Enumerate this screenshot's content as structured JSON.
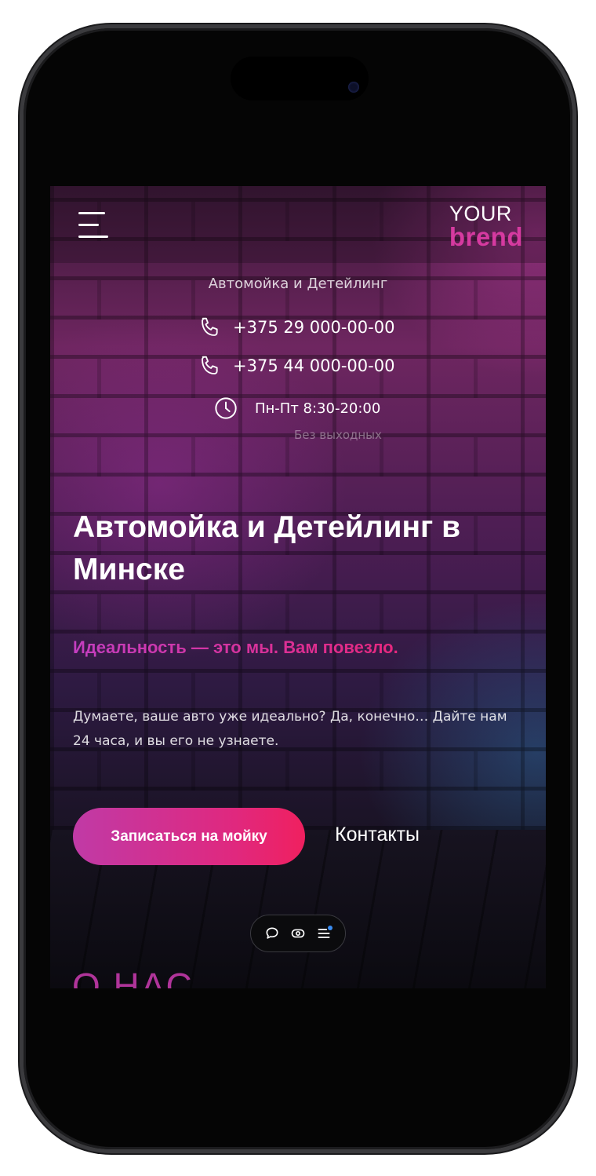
{
  "header": {
    "logo_top": "YOUR",
    "logo_bottom": "brend"
  },
  "contacts": {
    "subtitle": "Автомойка и Детейлинг",
    "phone1": "+375 29 000-00-00",
    "phone2": "+375 44 000-00-00",
    "hours": "Пн-Пт 8:30-20:00",
    "no_weekends": "Без выходных",
    "phone_icon": "phone-icon",
    "clock_icon": "clock-icon"
  },
  "hero": {
    "title": "Автомойка и Детейлинг в Минске",
    "tagline": "Идеальность — это мы. Вам повезло.",
    "description": "Думаете, ваше авто уже идеально? Да, конечно… Дайте нам 24 часа, и вы его не узнаете.",
    "cta_label": "Записаться на мойку",
    "contacts_label": "Контакты"
  },
  "floating_bar": {
    "icons": [
      "chat-icon",
      "toggle-icon",
      "menu-list-icon"
    ]
  },
  "about": {
    "title": "О НАС"
  },
  "colors": {
    "accent": "#d63aa0",
    "cta_start": "#c03aa6",
    "cta_end": "#f0205f"
  }
}
